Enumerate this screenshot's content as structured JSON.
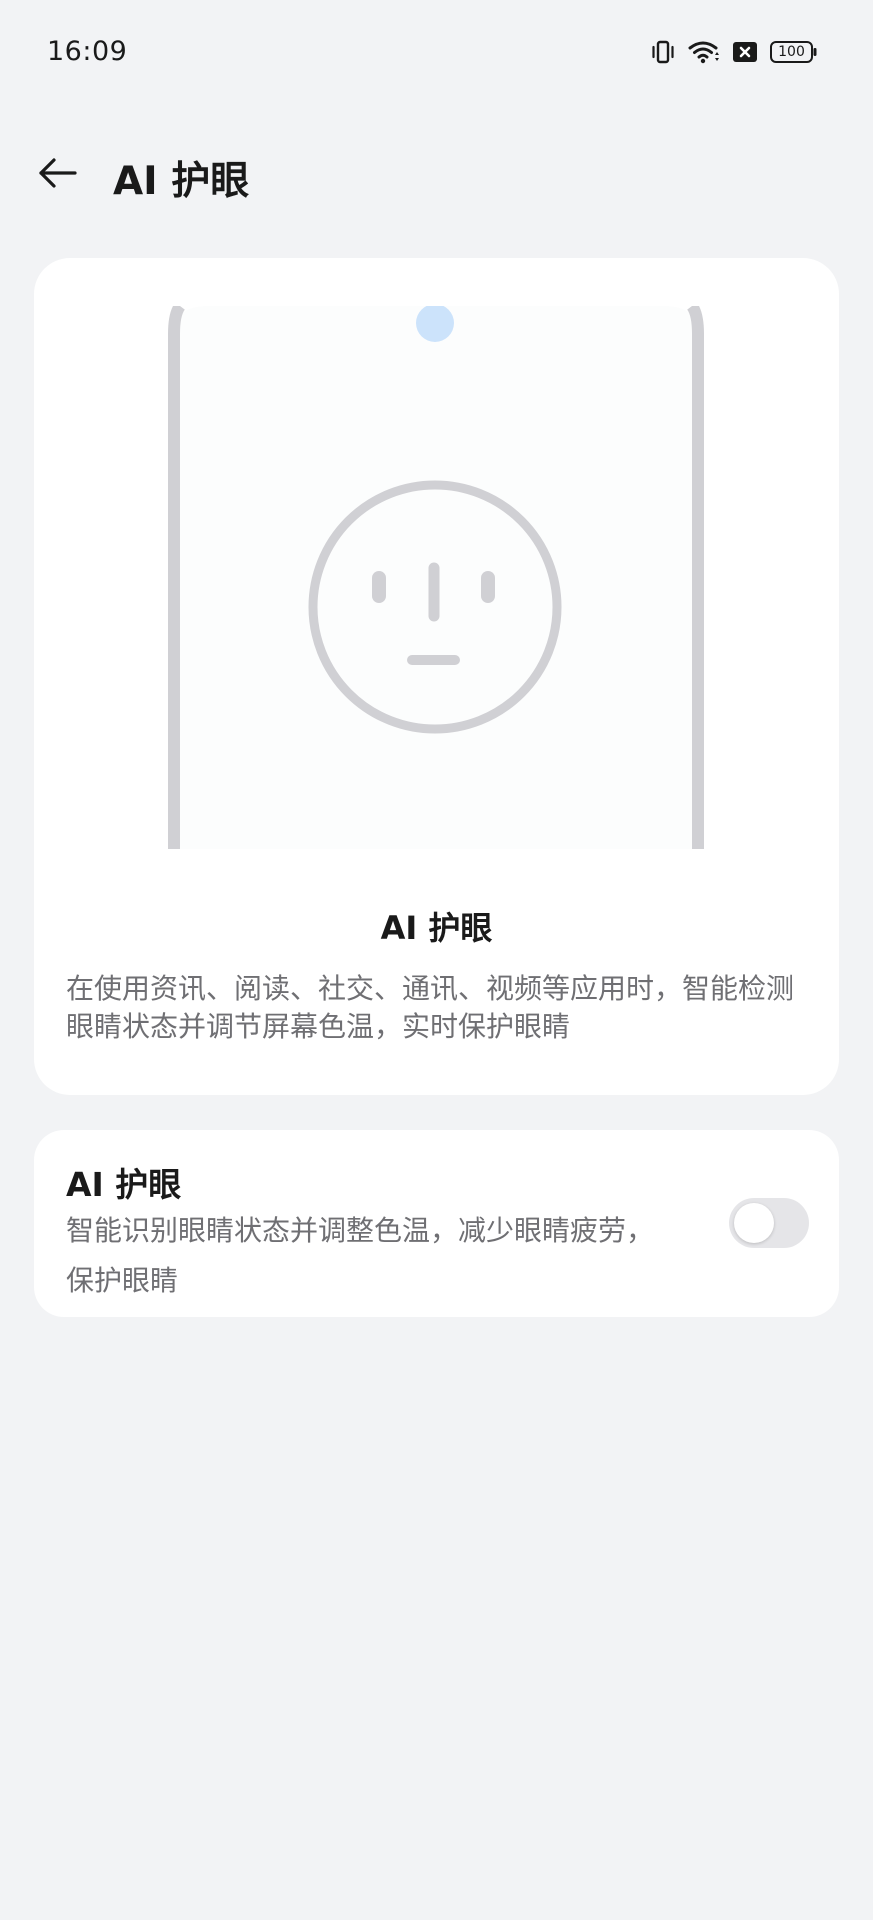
{
  "status_bar": {
    "time": "16:09",
    "battery": "100",
    "icons": [
      "vibrate-icon",
      "wifi-icon",
      "sim-blocked-icon",
      "battery-icon"
    ]
  },
  "header": {
    "title": "AI 护眼",
    "back_icon": "arrow-left-icon"
  },
  "hero": {
    "title": "AI 护眼",
    "description": "在使用资讯、阅读、社交、通讯、视频等应用时，智能检测眼睛状态并调节屏幕色温，实时保护眼睛"
  },
  "setting": {
    "title": "AI 护眼",
    "description": "智能识别眼睛状态并调整色温，减少眼睛疲劳，保护眼睛",
    "enabled": false
  },
  "colors": {
    "background": "#f2f3f5",
    "card": "#ffffff",
    "text_primary": "#1a1a1a",
    "text_secondary": "#6f6f73",
    "illustration_stroke": "#d0d0d4",
    "camera_dot": "#cce3fb",
    "toggle_off": "#e5e5e8"
  }
}
